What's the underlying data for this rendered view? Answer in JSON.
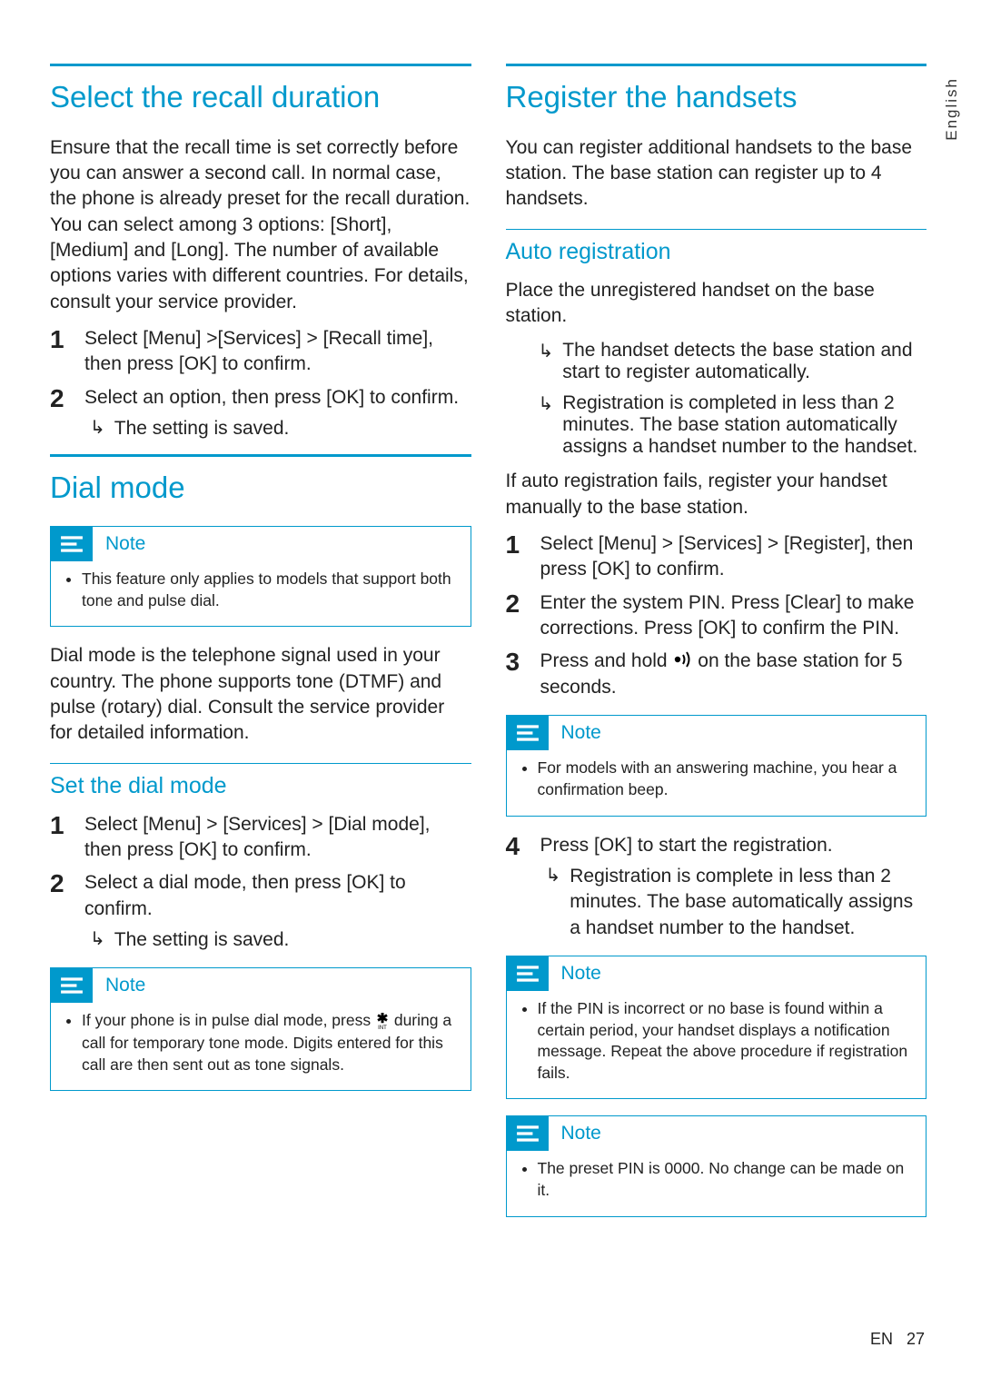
{
  "language_tab": "English",
  "footer": {
    "lang": "EN",
    "page": "27"
  },
  "left": {
    "section1": {
      "title": "Select the recall duration",
      "intro": "Ensure that the recall time is set correctly before you can answer a second call. In normal case, the phone is already preset for the recall duration. You can select among 3 options: [Short], [Medium] and [Long]. The number of available options varies with different countries. For details, consult your service provider.",
      "steps": [
        {
          "n": "1",
          "t": "Select [Menu] >[Services] > [Recall time], then press [OK] to confirm."
        },
        {
          "n": "2",
          "t": "Select an option, then press [OK] to confirm.",
          "r": "The setting is saved."
        }
      ]
    },
    "section2": {
      "title": "Dial mode",
      "note1": "This feature only applies to models that support both tone and pulse dial.",
      "intro": "Dial mode is the telephone signal used in your country. The phone supports tone (DTMF) and pulse (rotary) dial. Consult the service provider for detailed information.",
      "sub": "Set the dial mode",
      "steps": [
        {
          "n": "1",
          "t": "Select [Menu] > [Services] > [Dial mode], then press [OK] to confirm."
        },
        {
          "n": "2",
          "t": "Select a dial mode, then press [OK] to confirm.",
          "r": "The setting is saved."
        }
      ],
      "note2_pre": "If your phone is in pulse dial mode, press ",
      "note2_post": " during a call for temporary tone mode. Digits entered for this call are then sent out as tone signals."
    }
  },
  "right": {
    "section1": {
      "title": "Register the handsets",
      "intro": "You can register additional handsets to the base station. The base station can register up to 4 handsets.",
      "sub": "Auto registration",
      "sub_intro": "Place the unregistered handset on the base station.",
      "results": [
        "The handset detects the base station and start to register automatically.",
        "Registration is completed in less than 2 minutes. The base station automatically assigns a handset number to the handset."
      ],
      "after": "If auto registration fails, register your handset manually to the base station.",
      "steps": [
        {
          "n": "1",
          "t": "Select [Menu] > [Services] > [Register], then press [OK] to confirm."
        },
        {
          "n": "2",
          "t": "Enter the system PIN. Press [Clear] to make corrections. Press [OK] to confirm the PIN."
        },
        {
          "n": "3",
          "t_pre": "Press and hold ",
          "t_post": " on the base station for 5 seconds."
        }
      ],
      "note1": "For models with an answering machine, you hear a confirmation beep.",
      "step4": {
        "n": "4",
        "t": "Press [OK] to start the registration.",
        "r": "Registration is complete in less than 2 minutes. The base automatically assigns a handset number to the handset."
      },
      "note2": "If the PIN is incorrect or no base is found within a certain period, your handset displays a notification message. Repeat the above procedure if registration fails.",
      "note3": "The preset PIN is 0000. No change can be made on it."
    }
  },
  "note_label": "Note"
}
